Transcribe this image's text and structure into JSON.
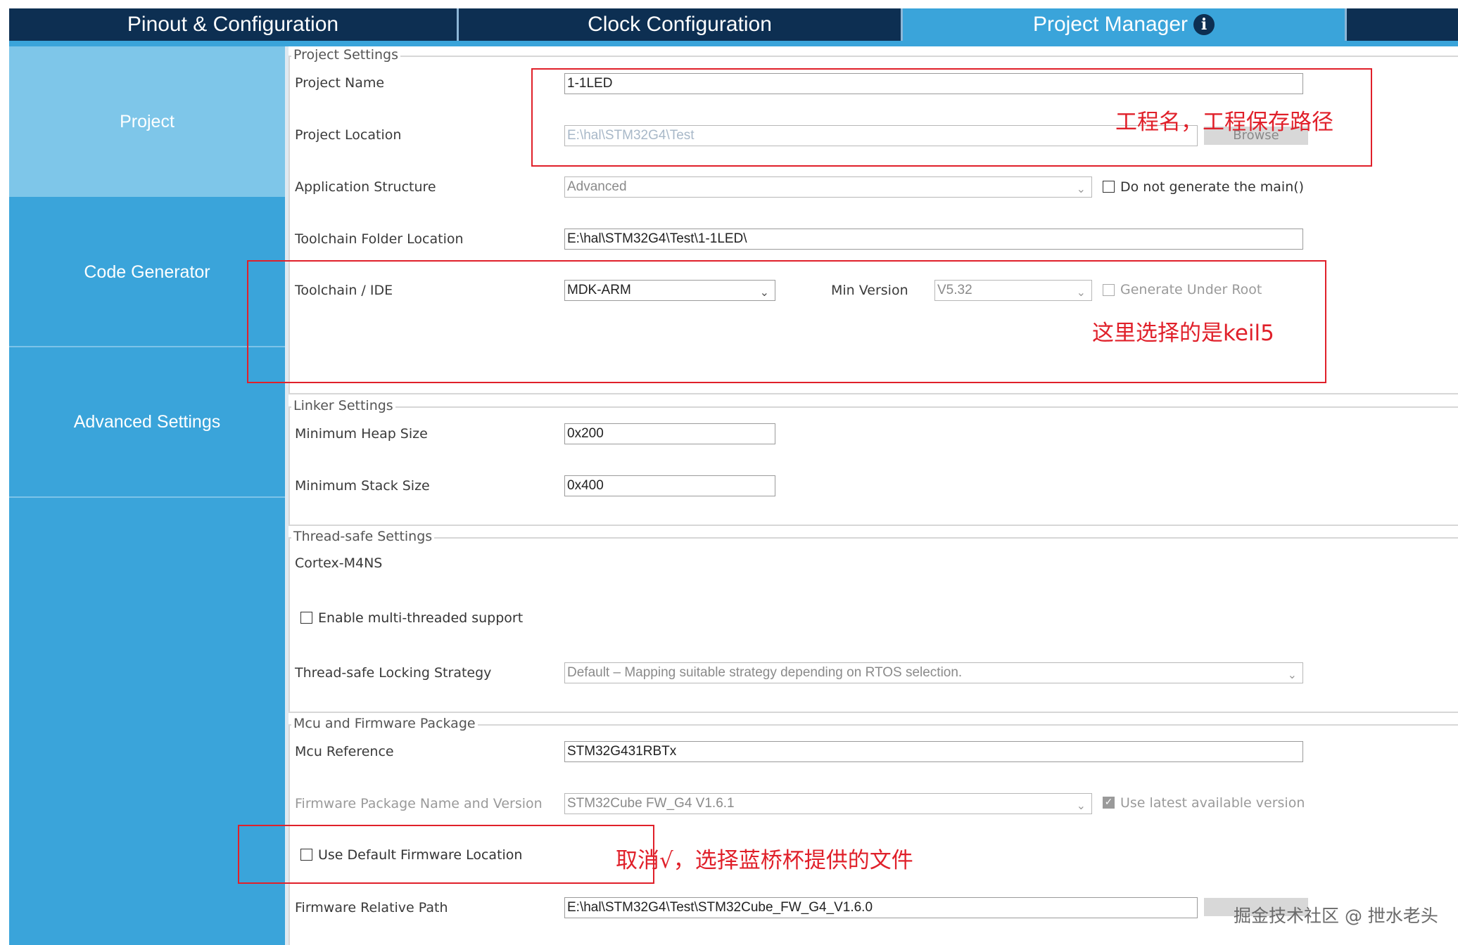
{
  "tabs": [
    {
      "label": "Pinout & Configuration",
      "active": false
    },
    {
      "label": "Clock Configuration",
      "active": false
    },
    {
      "label": "Project Manager",
      "active": true,
      "icon": "info-icon"
    }
  ],
  "sidebar": {
    "items": [
      {
        "label": "Project",
        "selected": true
      },
      {
        "label": "Code Generator",
        "selected": false
      },
      {
        "label": "Advanced Settings",
        "selected": false
      }
    ]
  },
  "project_settings": {
    "title": "Project Settings",
    "project_name_label": "Project Name",
    "project_name_value": "1-1LED",
    "project_location_label": "Project Location",
    "project_location_value": "E:\\hal\\STM32G4\\Test",
    "browse_label": "Browse",
    "app_structure_label": "Application Structure",
    "app_structure_value": "Advanced",
    "no_main_label": "Do not generate the main()",
    "toolchain_folder_label": "Toolchain Folder Location",
    "toolchain_folder_value": "E:\\hal\\STM32G4\\Test\\1-1LED\\",
    "toolchain_label": "Toolchain / IDE",
    "toolchain_value": "MDK-ARM",
    "min_version_label": "Min Version",
    "min_version_value": "V5.32",
    "gen_under_root_label": "Generate Under Root"
  },
  "linker_settings": {
    "title": "Linker Settings",
    "heap_label": "Minimum Heap Size",
    "heap_value": "0x200",
    "stack_label": "Minimum Stack Size",
    "stack_value": "0x400"
  },
  "thread_safe": {
    "title": "Thread-safe Settings",
    "core": "Cortex-M4NS",
    "multithread_label": "Enable multi-threaded support",
    "locking_label": "Thread-safe Locking Strategy",
    "locking_value": "Default  –  Mapping suitable strategy depending on RTOS selection."
  },
  "mcu_firmware": {
    "title": "Mcu and Firmware Package",
    "mcu_ref_label": "Mcu Reference",
    "mcu_ref_value": "STM32G431RBTx",
    "fw_pkg_label": "Firmware Package Name and Version",
    "fw_pkg_value": "STM32Cube FW_G4 V1.6.1",
    "use_latest_label": "Use latest available version",
    "default_fw_loc_label": "Use Default Firmware Location",
    "fw_rel_path_label": "Firmware Relative Path",
    "fw_rel_path_value": "E:\\hal\\STM32G4\\Test\\STM32Cube_FW_G4_V1.6.0"
  },
  "annotations": {
    "project_name_note": "工程名，工程保存路径",
    "toolchain_note": "这里选择的是keil5",
    "firmware_note": "取消√，选择蓝桥杯提供的文件"
  },
  "watermark": "掘金技术社区 @ 抴水老头",
  "colors": {
    "tab_bar": "#0d2f52",
    "accent_blue": "#3aa4da",
    "selected_sidebar": "#7ec6e9",
    "annotation_red": "#e0202a"
  }
}
